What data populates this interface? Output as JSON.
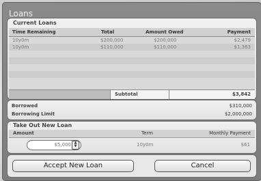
{
  "window": {
    "title": "Loans"
  },
  "current_loans": {
    "heading": "Current Loans",
    "columns": [
      "Time Remaining",
      "Total",
      "Amount Owed",
      "Payment"
    ],
    "rows": [
      {
        "time": "10y0m",
        "total": "$200,000",
        "owed": "$200,000",
        "payment": "$2,479"
      },
      {
        "time": "10y0m",
        "total": "$110,000",
        "owed": "$110,000",
        "payment": "$1,363"
      }
    ],
    "subtotal_label": "Subtotal",
    "subtotal_value": "$3,842"
  },
  "summary": {
    "borrowed_label": "Borrowed",
    "borrowed_value": "$310,000",
    "limit_label": "Borrowing Limit",
    "limit_value": "$2,000,000"
  },
  "new_loan": {
    "heading": "Take Out New Loan",
    "amount_label": "Amount",
    "term_label": "Term",
    "monthly_label": "Monthly Payment",
    "amount_value": "$5,000",
    "term_value": "10y0m",
    "monthly_value": "$61"
  },
  "buttons": {
    "accept": "Accept New Loan",
    "cancel": "Cancel"
  }
}
